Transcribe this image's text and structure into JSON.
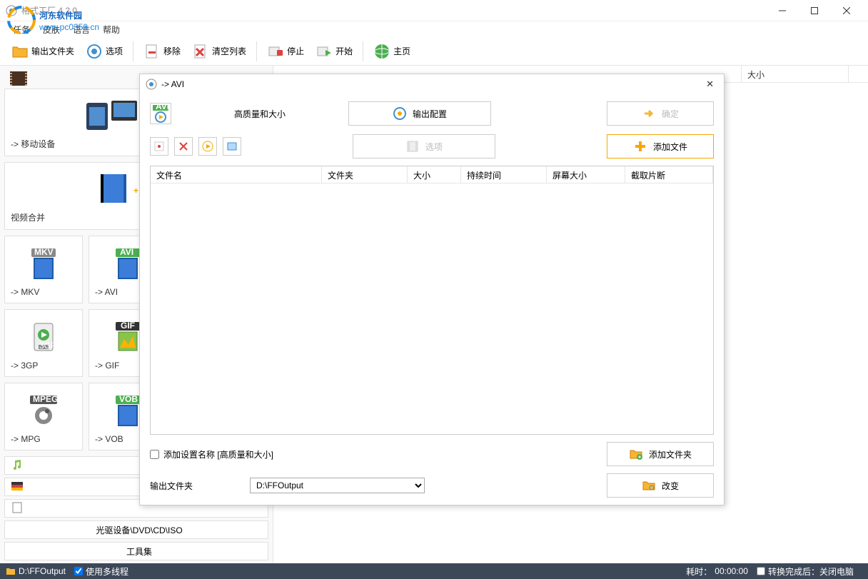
{
  "window": {
    "title": "格式工厂 4.2.0"
  },
  "watermark": {
    "line1": "河东软件园",
    "line2": "www.pc0359.cn"
  },
  "menu": {
    "task": "任务",
    "skin": "皮肤",
    "language": "语言",
    "help": "帮助"
  },
  "toolbar": {
    "output_folder": "输出文件夹",
    "options": "选项",
    "remove": "移除",
    "clear_list": "清空列表",
    "stop": "停止",
    "start": "开始",
    "homepage": "主页"
  },
  "content_header": {
    "size": "大小"
  },
  "sidebar": {
    "mobile_device": "-> 移动设备",
    "video_merge": "视频合并",
    "mkv": "-> MKV",
    "avi": "-> AVI",
    "gp3": "-> 3GP",
    "gif": "-> GIF",
    "mpg": "-> MPG",
    "vob": "-> VOB",
    "optical": "光驱设备\\DVD\\CD\\ISO",
    "tools": "工具集"
  },
  "dialog": {
    "title": "-> AVI",
    "quality_label": "高质量和大小",
    "output_config": "输出配置",
    "ok": "确定",
    "options": "选项",
    "add_file": "添加文件",
    "table": {
      "filename": "文件名",
      "folder": "文件夹",
      "size": "大小",
      "duration": "持续时间",
      "screen_size": "屏幕大小",
      "clip": "截取片断"
    },
    "add_setting_name": "添加设置名称 [高质量和大小]",
    "add_folder": "添加文件夹",
    "output_folder_label": "输出文件夹",
    "output_path": "D:\\FFOutput",
    "change": "改变"
  },
  "statusbar": {
    "output_path": "D:\\FFOutput",
    "multithread": "使用多线程",
    "elapsed_label": "耗时：",
    "elapsed_value": "00:00:00",
    "after_convert": "转换完成后：关闭电脑"
  }
}
